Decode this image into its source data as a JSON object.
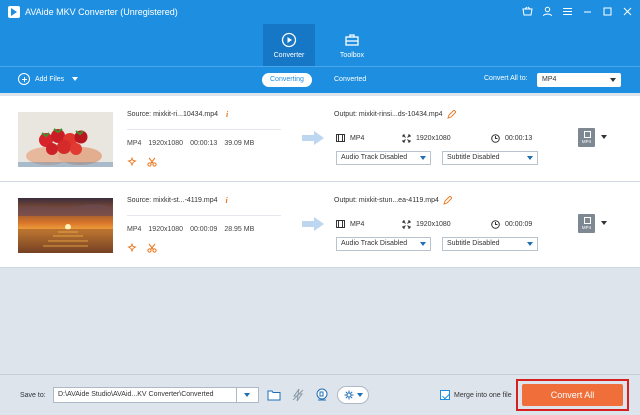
{
  "window": {
    "title": "AVAide MKV Converter (Unregistered)",
    "controls": [
      "basket-icon",
      "user-icon",
      "menu-icon",
      "minimize-icon",
      "maximize-icon",
      "close-icon"
    ]
  },
  "nav": {
    "tabs": [
      {
        "label": "Converter",
        "icon": "converter-icon",
        "active": true
      },
      {
        "label": "Toolbox",
        "icon": "toolbox-icon",
        "active": false
      }
    ]
  },
  "toolbar": {
    "add_files": "Add Files",
    "tabs": [
      {
        "label": "Converting",
        "active": true
      },
      {
        "label": "Converted",
        "active": false
      }
    ],
    "convert_all_to_label": "Convert All to:",
    "convert_all_to_value": "MP4"
  },
  "files": [
    {
      "source": "Source: mixkit-ri...10434.mp4",
      "format": "MP4",
      "resolution": "1920x1080",
      "duration": "00:00:13",
      "size": "39.09 MB",
      "output": "Output: mixkit-rinsi...ds-10434.mp4",
      "out_format": "MP4",
      "out_resolution": "1920x1080",
      "out_duration": "00:00:13",
      "audio_track": "Audio Track Disabled",
      "subtitle": "Subtitle Disabled",
      "badge": "MP4",
      "thumb": "strawberries-in-hands"
    },
    {
      "source": "Source: mixkit-st...-4119.mp4",
      "format": "MP4",
      "resolution": "1920x1080",
      "duration": "00:00:09",
      "size": "28.95 MB",
      "output": "Output: mixkit-stun...ea-4119.mp4",
      "out_format": "MP4",
      "out_resolution": "1920x1080",
      "out_duration": "00:00:09",
      "audio_track": "Audio Track Disabled",
      "subtitle": "Subtitle Disabled",
      "badge": "MP4",
      "thumb": "sunset-over-sea"
    }
  ],
  "bottom": {
    "save_to_label": "Save to:",
    "save_path": "D:\\AVAide Studio\\AVAid...KV Converter\\Converted",
    "merge_label": "Merge into one file",
    "merge_checked": true,
    "convert_all": "Convert All"
  },
  "colors": {
    "accent": "#1e8fe0",
    "convert_button": "#f06e39",
    "highlight_frame": "#d6201f",
    "icon_orange": "#e8771f"
  }
}
